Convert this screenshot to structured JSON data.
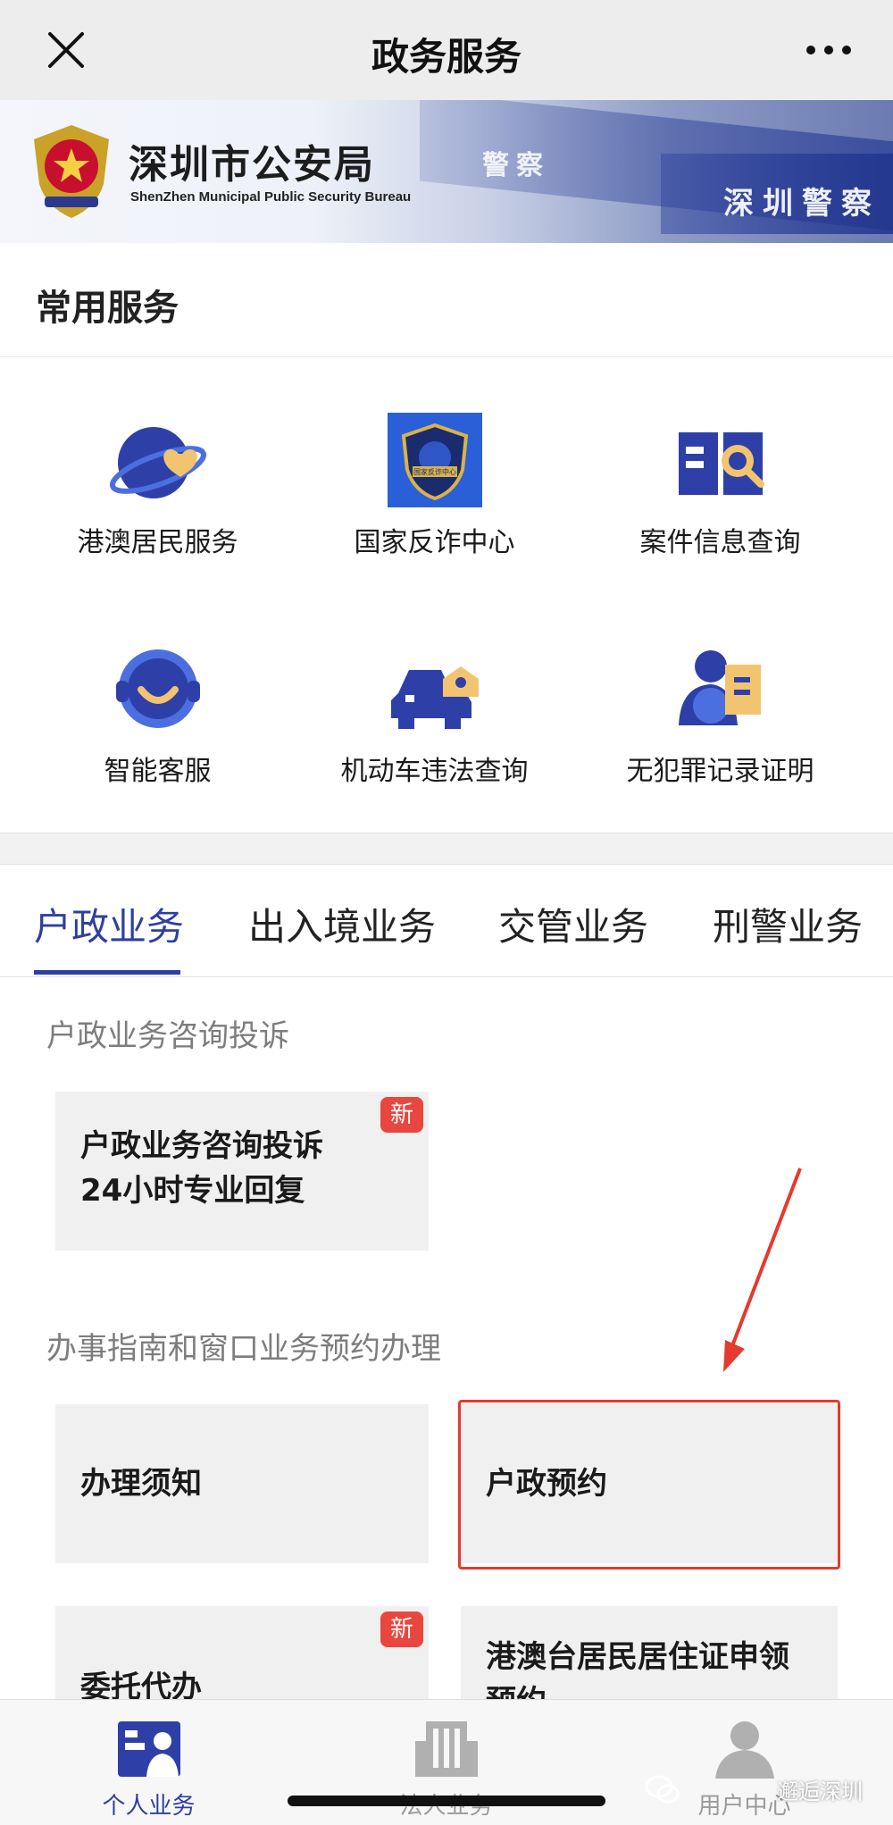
{
  "header": {
    "title": "政务服务",
    "close_icon": "close-icon",
    "more_icon": "more-icon"
  },
  "banner": {
    "org_name_cn": "深圳市公安局",
    "org_name_en": "ShenZhen Municipal Public Security Bureau",
    "stripe_text_1": "警察",
    "stripe_text_2": "深圳警察"
  },
  "common_services": {
    "title": "常用服务",
    "items": [
      {
        "label": "港澳居民服务",
        "icon": "hk-macau-resident-icon"
      },
      {
        "label": "国家反诈中心",
        "icon": "anti-fraud-center-icon",
        "icon_text": "国家反诈中心"
      },
      {
        "label": "案件信息查询",
        "icon": "case-query-icon"
      },
      {
        "label": "智能客服",
        "icon": "smart-service-icon"
      },
      {
        "label": "机动车违法查询",
        "icon": "vehicle-violation-icon"
      },
      {
        "label": "无犯罪记录证明",
        "icon": "no-criminal-record-icon"
      }
    ]
  },
  "tabs": [
    {
      "label": "户政业务",
      "active": true
    },
    {
      "label": "出入境业务",
      "active": false
    },
    {
      "label": "交管业务",
      "active": false
    },
    {
      "label": "刑警业务",
      "active": false
    }
  ],
  "content": {
    "category_1": "户政业务咨询投诉",
    "card_consult": {
      "line1": "户政业务咨询投诉",
      "line2": "24小时专业回复",
      "badge": "新"
    },
    "category_2": "办事指南和窗口业务预约办理",
    "card_guide": "办理须知",
    "card_appointment": "户政预约",
    "card_entrust": {
      "label": "委托代办",
      "badge": "新"
    },
    "card_residence": {
      "line1": "港澳台居民居住证申领",
      "line2": "预约"
    }
  },
  "bottom_nav": [
    {
      "label": "个人业务",
      "icon": "personal-business-icon",
      "active": true
    },
    {
      "label": "法人业务",
      "icon": "corporate-business-icon",
      "active": false
    },
    {
      "label": "用户中心",
      "icon": "user-center-icon",
      "active": false
    }
  ],
  "watermark": "邂逅深圳",
  "colors": {
    "accent": "#2e3f9e",
    "badge": "#e8463e",
    "highlight": "#e53a2e"
  }
}
